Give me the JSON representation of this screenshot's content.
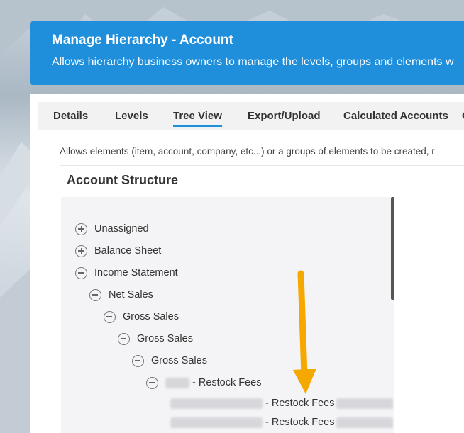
{
  "header": {
    "title": "Manage Hierarchy - Account",
    "subtitle": "Allows hierarchy business owners to manage the levels, groups and elements w"
  },
  "tabs": [
    {
      "label": "Details",
      "active": false
    },
    {
      "label": "Levels",
      "active": false
    },
    {
      "label": "Tree View",
      "active": true
    },
    {
      "label": "Export/Upload",
      "active": false
    },
    {
      "label": "Calculated Accounts",
      "active": false
    },
    {
      "label": "C",
      "active": false
    }
  ],
  "description": "Allows elements (item, account, company, etc...) or a groups of elements to be created, r",
  "section_title": "Account Structure",
  "tree": {
    "nodes": [
      {
        "label": "Unassigned",
        "state": "collapsed"
      },
      {
        "label": "Balance Sheet",
        "state": "collapsed"
      },
      {
        "label": "Income Statement",
        "state": "expanded"
      },
      {
        "label": "Net Sales",
        "state": "expanded"
      },
      {
        "label": "Gross Sales",
        "state": "expanded"
      },
      {
        "label": "Gross Sales",
        "state": "expanded"
      },
      {
        "label": "Gross Sales",
        "state": "expanded"
      },
      {
        "label": "- Restock Fees",
        "state": "expanded"
      },
      {
        "label": "- Restock Fees",
        "state": "leaf"
      },
      {
        "label": "- Restock Fees",
        "state": "leaf"
      }
    ]
  },
  "colors": {
    "header_bg": "#1f8fdc",
    "arrow": "#f5a800",
    "tab_active_underline": "#1f8fdc"
  }
}
